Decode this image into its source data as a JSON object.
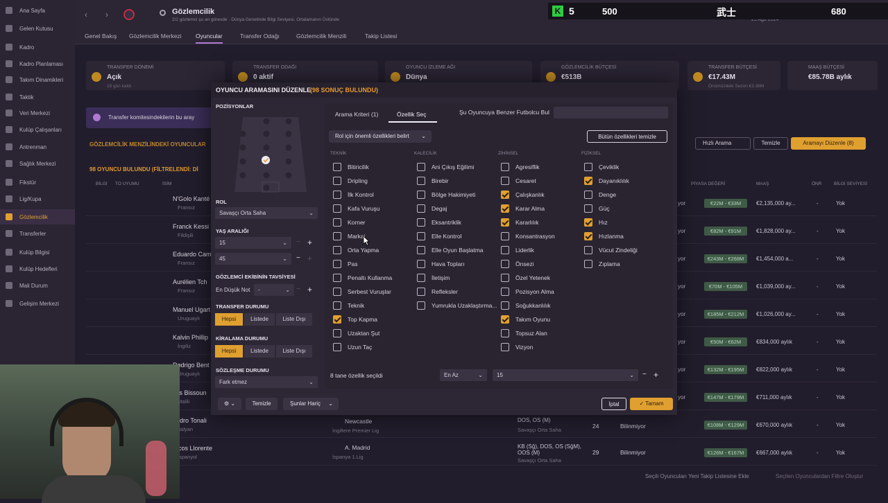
{
  "sidebar": {
    "items": [
      "Ana Sayfa",
      "Gelen Kutusu",
      "Kadro",
      "Kadro Planlaması",
      "Takım Dinamikleri",
      "Taktik",
      "Veri Merkezi",
      "Kulüp Çalışanları",
      "Antrenman",
      "Sağlık Merkezi",
      "Fikstür",
      "Lig/Kupa",
      "Gözlemcilik",
      "Transferler",
      "Kulüp Bilgisi",
      "Kulüp Hedefleri",
      "Mali Durum",
      "Gelişim Merkezi"
    ],
    "active_index": 12
  },
  "topbar": {
    "title": "Gözlemcilik",
    "subtitle": "2/2 gözlemci şu an görevde · Dünya Genelinde Bilgi Seviyesi, Ortalamanın Üstünde",
    "date": "25 Ağu 2024"
  },
  "scorebar": {
    "k_value": "5",
    "score1": "500",
    "kanji": "武士",
    "score2": "680"
  },
  "tabs": [
    "Genel Bakış",
    "Gözlemcilik Merkezi",
    "Oyuncular",
    "Transfer Odağı",
    "Gözlemcilik Menzili",
    "Takip Listesi"
  ],
  "tabs_selected": 2,
  "cards": [
    {
      "label": "TRANSFER DÖNEMİ",
      "value": "Açık",
      "sub": "18 gün kaldı"
    },
    {
      "label": "TRANSFER ODAĞI",
      "value": "0 aktif",
      "sub": ""
    },
    {
      "label": "OYUNCU İZLEME AĞI",
      "value": "Dünya",
      "sub": ""
    },
    {
      "label": "GÖZLEMCİLİK BÜTÇESİ",
      "value": "€513B",
      "sub": ""
    },
    {
      "label": "TRANSFER BÜTÇESİ",
      "value": "€17.43M",
      "sub": "Önümüzdeki Sezon €3.36M"
    },
    {
      "label": "MAAŞ BÜTÇESİ",
      "value": "€85.78B aylık",
      "sub": ""
    }
  ],
  "banner": "Transfer komitesindekilerin bu aray",
  "background": {
    "range_title": "GÖZLEMCİLİK MENZİLİNDEKİ OYUNCULAR",
    "found_title": "98 OYUNCU BULUNDU (FİLTRELENDİ: Dİ",
    "col_bilgi": "BİLGİ",
    "col_to_uyumu": "TO UYUMU",
    "col_isim": "İSİM",
    "col_piyasa": "PİYASA DEĞERİ",
    "col_maas": "MAAŞ",
    "col_onr": "ÖNR",
    "col_bilgi_sev": "BİLGİ SEVİYESİ",
    "btn_hizli": "Hızlı Arama",
    "btn_temizle": "Temizle",
    "btn_aramayi": "Aramayı Düzenle (8)",
    "players": [
      {
        "name": "N'Golo Kanté",
        "country": "Fransız",
        "value": "€22M - €33M",
        "salary": "€2,135,000 ay...",
        "onr": "-",
        "bilgi": "Yok"
      },
      {
        "name": "Franck Kessi",
        "country": "Fildişili",
        "value": "€82M - €91M",
        "salary": "€1,828,000 ay...",
        "onr": "-",
        "bilgi": "Yok"
      },
      {
        "name": "Eduardo Cam",
        "country": "Fransız",
        "value": "€243M - €268M",
        "salary": "€1,454,000 a...",
        "onr": "-",
        "bilgi": "Yok"
      },
      {
        "name": "Aurélien Tch",
        "country": "Fransız",
        "value": "€70M - €105M",
        "salary": "€1,039,000 ay...",
        "onr": "-",
        "bilgi": "Yok"
      },
      {
        "name": "Manuel Ugart",
        "country": "Uruguaylı",
        "value": "€185M - €212M",
        "salary": "€1,026,000 ay...",
        "onr": "-",
        "bilgi": "Yok"
      },
      {
        "name": "Kalvin Phillip",
        "country": "İngiliz",
        "value": "€50M - €62M",
        "salary": "€834,000 aylık",
        "onr": "-",
        "bilgi": "Yok"
      },
      {
        "name": "Rodrigo Bent",
        "country": "Uruguaylı",
        "value": "€132M - €195M",
        "salary": "€822,000 aylık",
        "onr": "-",
        "bilgi": "Yok"
      },
      {
        "name": "ves Bissoun",
        "country": "Malili",
        "value": "€147M - €179M",
        "salary": "€711,000 aylık",
        "onr": "-",
        "bilgi": "Yok"
      },
      {
        "name": "andro Tonali",
        "country": "İtalyan",
        "value": "€108M - €129M",
        "salary": "€670,000 aylık",
        "onr": "-",
        "bilgi": "Yok"
      },
      {
        "name": "arcos Llorente",
        "country": "İspanyol",
        "value": "€126M - €167M",
        "salary": "€667,000 aylık",
        "onr": "-",
        "bilgi": "Yok"
      }
    ],
    "extra_rows": [
      {
        "club": "Newcastle",
        "league": "İngiltere Premier Lig",
        "pos": "DOS, OS (M)",
        "role": "Savaşçı Orta Saha",
        "age": "24",
        "status": "Bilinmiyor"
      },
      {
        "club": "A. Madrid",
        "league": "İspanya 1.Lig",
        "pos": "KB (Sğ), DOS, OS (SğM), OOS (M)",
        "role": "Savaşçı Orta Saha",
        "age": "29",
        "status": "Bilinmiyor"
      }
    ],
    "vor_label": "yor",
    "footer_add": "Seçili Oyuncuları Yeni Takip Listesine Ekle",
    "footer_filter": "Seçilen Oyunculardan Filtre Oluştur"
  },
  "modal": {
    "title": "OYUNCU ARAMASINI DÜZENLE",
    "count": "(98 SONUÇ BULUNDU)",
    "positions_label": "POZİSYONLAR",
    "rol_label": "ROL",
    "rol_value": "Savaşçı Orta Saha",
    "age_label": "YAŞ ARALIĞI",
    "age_min": "15",
    "age_max": "45",
    "scout_label": "GÖZLEMCİ EKİBİNİN TAVSİYESİ",
    "scout_min_label": "En Düşük Not",
    "scout_min_value": "-",
    "transfer_label": "TRANSFER DURUMU",
    "loan_label": "KİRALAMA DURUMU",
    "seg_options": [
      "Hepsi",
      "Listede",
      "Liste Dışı"
    ],
    "contract_label": "SÖZLEŞME DURUMU",
    "contract_value": "Fark etmez",
    "tab_criteria": "Arama Kriteri (1)",
    "tab_attrs": "Özellik Seç",
    "similar_label": "Şu Oyuncuya Benzer Futbolcu Bul",
    "role_important": "Rol için önemli özellikleri belirt",
    "clear_all": "Bütün özellikleri temizle",
    "columns": [
      {
        "header": "TEKNİK",
        "items": [
          {
            "name": "Bitiricilik",
            "checked": false
          },
          {
            "name": "Dripling",
            "checked": false
          },
          {
            "name": "İlk Kontrol",
            "checked": false
          },
          {
            "name": "Kafa Vuruşu",
            "checked": false
          },
          {
            "name": "Korner",
            "checked": false
          },
          {
            "name": "Markaj",
            "checked": false
          },
          {
            "name": "Orta Yapma",
            "checked": false
          },
          {
            "name": "Pas",
            "checked": false
          },
          {
            "name": "Penaltı Kullanma",
            "checked": false
          },
          {
            "name": "Serbest Vuruşlar",
            "checked": false
          },
          {
            "name": "Teknik",
            "checked": false
          },
          {
            "name": "Top Kapma",
            "checked": true
          },
          {
            "name": "Uzaktan Şut",
            "checked": false
          },
          {
            "name": "Uzun Taç",
            "checked": false
          }
        ]
      },
      {
        "header": "KALECİLİK",
        "items": [
          {
            "name": "Ani Çıkış Eğilimi",
            "checked": false
          },
          {
            "name": "Birebir",
            "checked": false
          },
          {
            "name": "Bölge Hakimiyeti",
            "checked": false
          },
          {
            "name": "Degaj",
            "checked": false
          },
          {
            "name": "Eksantriklik",
            "checked": false
          },
          {
            "name": "Elle Kontrol",
            "checked": false
          },
          {
            "name": "Elle Oyun Başlatma",
            "checked": false
          },
          {
            "name": "Hava Topları",
            "checked": false
          },
          {
            "name": "İletişim",
            "checked": false
          },
          {
            "name": "Refleksler",
            "checked": false
          },
          {
            "name": "Yumrukla Uzaklaştırma...",
            "checked": false
          }
        ]
      },
      {
        "header": "ZİHİNSEL",
        "items": [
          {
            "name": "Agresiflik",
            "checked": false
          },
          {
            "name": "Cesaret",
            "checked": false
          },
          {
            "name": "Çalışkanlık",
            "checked": true
          },
          {
            "name": "Karar Alma",
            "checked": true
          },
          {
            "name": "Kararlılık",
            "checked": true
          },
          {
            "name": "Konsantrasyon",
            "checked": false
          },
          {
            "name": "Liderlik",
            "checked": false
          },
          {
            "name": "Önsezi",
            "checked": false
          },
          {
            "name": "Özel Yetenek",
            "checked": false
          },
          {
            "name": "Pozisyon Alma",
            "checked": false
          },
          {
            "name": "Soğukkanlılık",
            "checked": false
          },
          {
            "name": "Takım Oyunu",
            "checked": true
          },
          {
            "name": "Topsuz Alan",
            "checked": false
          },
          {
            "name": "Vizyon",
            "checked": false
          }
        ]
      },
      {
        "header": "FİZİKSEL",
        "items": [
          {
            "name": "Çeviklik",
            "checked": false
          },
          {
            "name": "Dayanıklılık",
            "checked": true
          },
          {
            "name": "Denge",
            "checked": false
          },
          {
            "name": "Güç",
            "checked": false
          },
          {
            "name": "Hız",
            "checked": true
          },
          {
            "name": "Hızlanma",
            "checked": true
          },
          {
            "name": "Vücut Zindeliği",
            "checked": false
          },
          {
            "name": "Zıplama",
            "checked": false
          }
        ]
      }
    ],
    "selected_count": "8 tane özellik seçildi",
    "min_label": "En Az",
    "min_value": "15",
    "clear": "Temizle",
    "except": "Şunlar Hariç",
    "cancel": "İptal",
    "ok": "Tamam"
  }
}
